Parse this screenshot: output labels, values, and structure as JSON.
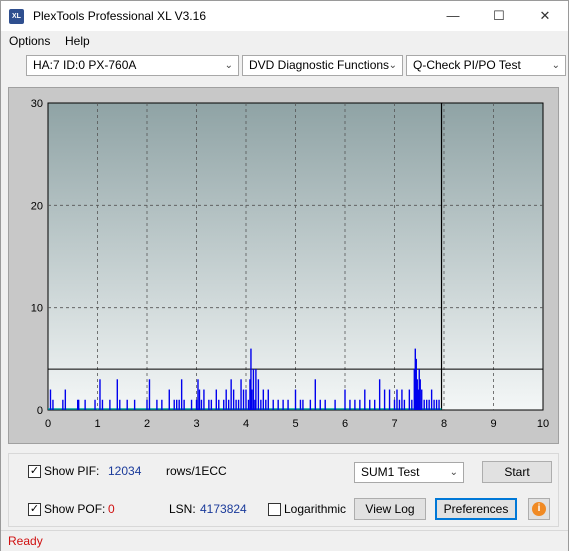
{
  "window": {
    "title": "PlexTools Professional XL V3.16",
    "icon_text": "XL",
    "minimize_glyph": "—",
    "maximize_glyph": "☐",
    "close_glyph": "✕"
  },
  "menu": {
    "options": "Options",
    "help": "Help"
  },
  "toolbar": {
    "drive_select": "HA:7 ID:0  PX-760A",
    "function_select": "DVD Diagnostic Functions",
    "test_select": "Q-Check PI/PO Test",
    "arrow_glyph": "⌄"
  },
  "chart_data": {
    "type": "bar",
    "x_ticks": [
      "0",
      "1",
      "2",
      "3",
      "4",
      "5",
      "6",
      "7",
      "8",
      "9",
      "10"
    ],
    "y_ticks": [
      "0",
      "10",
      "20",
      "30"
    ],
    "xlim": [
      0,
      10
    ],
    "ylim": [
      0,
      30
    ],
    "grid": true,
    "threshold": 4,
    "end_marker_x": 7.95,
    "colors": {
      "bar": "#0000ee",
      "baseline": "#00a0a0",
      "bg_top": "#8fa3a5",
      "bg_bottom": "#f4f7f7"
    },
    "series": [
      {
        "values_x": [
          0.05,
          0.1,
          0.3,
          0.35,
          0.6,
          0.62,
          0.75,
          0.95,
          1.05,
          1.1,
          1.25,
          1.4,
          1.45,
          1.6,
          1.75,
          2.0,
          2.05,
          2.2,
          2.3,
          2.45,
          2.55,
          2.6,
          2.65,
          2.7,
          2.75,
          2.9,
          3.0,
          3.03,
          3.06,
          3.1,
          3.15,
          3.25,
          3.3,
          3.4,
          3.45,
          3.55,
          3.6,
          3.65,
          3.7,
          3.75,
          3.8,
          3.85,
          3.9,
          3.95,
          4.0,
          4.05,
          4.08,
          4.1,
          4.12,
          4.15,
          4.18,
          4.2,
          4.25,
          4.3,
          4.35,
          4.4,
          4.45,
          4.55,
          4.65,
          4.75,
          4.85,
          5.0,
          5.1,
          5.15,
          5.3,
          5.4,
          5.5,
          5.6,
          5.8,
          6.0,
          6.1,
          6.2,
          6.3,
          6.4,
          6.5,
          6.6,
          6.7,
          6.8,
          6.9,
          7.0,
          7.05,
          7.1,
          7.15,
          7.2,
          7.3,
          7.35,
          7.4,
          7.42,
          7.44,
          7.46,
          7.48,
          7.5,
          7.52,
          7.55,
          7.6,
          7.65,
          7.7,
          7.75,
          7.8,
          7.85,
          7.9
        ],
        "values_y": [
          2,
          1,
          1,
          2,
          1,
          1,
          1,
          1,
          3,
          1,
          1,
          3,
          1,
          1,
          1,
          1,
          3,
          1,
          1,
          2,
          1,
          1,
          1,
          3,
          1,
          1,
          1,
          3,
          2,
          1,
          2,
          1,
          1,
          2,
          1,
          1,
          2,
          1,
          3,
          2,
          1,
          1,
          3,
          2,
          2,
          1,
          3,
          6,
          2,
          4,
          1,
          4,
          3,
          1,
          2,
          1,
          2,
          1,
          1,
          1,
          1,
          2,
          1,
          1,
          1,
          3,
          1,
          1,
          1,
          2,
          1,
          1,
          1,
          2,
          1,
          1,
          3,
          2,
          2,
          1,
          2,
          1,
          2,
          1,
          2,
          1,
          4,
          6,
          5,
          3,
          2,
          4,
          3,
          2,
          1,
          1,
          1,
          2,
          1,
          1,
          1
        ]
      }
    ]
  },
  "controls": {
    "show_pif_label": "Show PIF:",
    "show_pif_checked": "✓",
    "pif_value": "12034",
    "pif_unit": "rows/1ECC",
    "show_pof_label": "Show POF:",
    "show_pof_checked": "✓",
    "pof_value": "0",
    "lsn_label": "LSN:",
    "lsn_value": "4173824",
    "logarithmic_label": "Logarithmic",
    "sum_select": "SUM1 Test",
    "start_button": "Start",
    "view_log_button": "View Log",
    "preferences_button": "Preferences",
    "info_glyph": "i"
  },
  "status": {
    "text": "Ready"
  }
}
